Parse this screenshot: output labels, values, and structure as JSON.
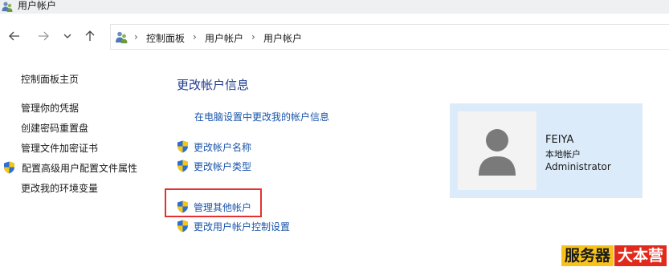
{
  "window": {
    "title": "用户帐户"
  },
  "nav": {
    "back_icon": "arrow-left-icon",
    "forward_icon": "arrow-right-icon",
    "recent_icon": "chevron-down-icon",
    "up_icon": "arrow-up-icon"
  },
  "breadcrumb": {
    "items": [
      "控制面板",
      "用户帐户",
      "用户帐户"
    ],
    "separator": "›"
  },
  "sidebar": {
    "home": "控制面板主页",
    "links": [
      "管理你的凭据",
      "创建密码重置盘",
      "管理文件加密证书",
      "配置高级用户配置文件属性",
      "更改我的环境变量"
    ]
  },
  "main": {
    "heading": "更改帐户信息",
    "pc_settings_link": "在电脑设置中更改我的帐户信息",
    "tasks": [
      "更改帐户名称",
      "更改帐户类型"
    ],
    "other_tasks": [
      "管理其他帐户",
      "更改用户帐户控制设置"
    ]
  },
  "user": {
    "name": "FEIYA",
    "type": "本地帐户",
    "role": "Administrator"
  },
  "watermark": {
    "part1": "服务器",
    "part2": "大本营"
  },
  "colors": {
    "link": "#1a55aa",
    "heading": "#1e3c8c",
    "card_bg": "#dcebf9",
    "highlight": "#e53030"
  }
}
